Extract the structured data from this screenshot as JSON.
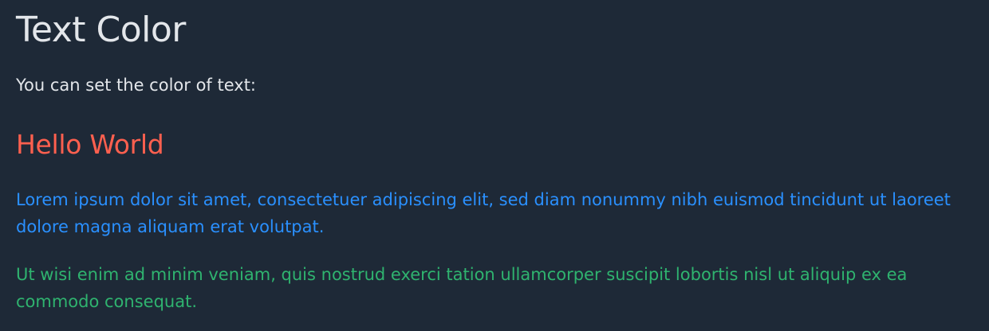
{
  "heading": "Text Color",
  "intro": "You can set the color of text:",
  "hello": "Hello World",
  "paragraph_blue": "Lorem ipsum dolor sit amet, consectetuer adipiscing elit, sed diam nonummy nibh euismod tincidunt ut laoreet dolore magna aliquam erat volutpat.",
  "paragraph_green": "Ut wisi enim ad minim veniam, quis nostrud exerci tation ullamcorper suscipit lobortis nisl ut aliquip ex ea commodo consequat.",
  "colors": {
    "background": "#1e2937",
    "heading_text": "#e3e6ea",
    "hello": "#ff604f",
    "paragraph_blue": "#2a90ff",
    "paragraph_green": "#2fb36f"
  }
}
